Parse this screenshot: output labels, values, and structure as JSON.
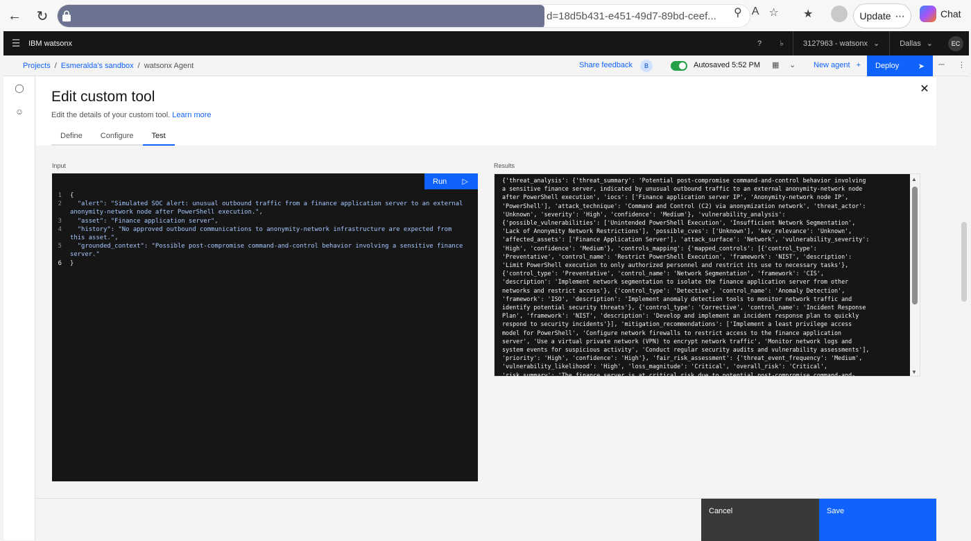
{
  "browser": {
    "url_visible": "d=18d5b431-e451-49d7-89bd-ceef...",
    "update_label": "Update",
    "chat_label": "Chat"
  },
  "app": {
    "brand": "IBM watsonx",
    "account": "3127963 - watsonx",
    "region": "Dallas",
    "avatar": "EC"
  },
  "subheader": {
    "crumb1": "Projects",
    "crumb2": "Esmeralda's sandbox",
    "crumb3": "watsonx Agent",
    "sep": "/",
    "share_feedback": "Share feedback",
    "badge": "B",
    "autosaved": "Autosaved 5:52 PM",
    "new_agent": "New agent",
    "deploy": "Deploy"
  },
  "modal": {
    "title": "Edit custom tool",
    "subtitle": "Edit the details of your custom tool.",
    "learn_more": "Learn more",
    "tabs": [
      "Define",
      "Configure",
      "Test"
    ],
    "active_tab": "Test",
    "input_label": "Input",
    "results_label": "Results",
    "run_label": "Run",
    "cancel_label": "Cancel",
    "save_label": "Save"
  },
  "input_code": {
    "l1": "{",
    "l2": "  \"alert\": \"Simulated SOC alert: unusual outbound traffic from a finance application server to an external anonymity-network node after PowerShell execution.\",",
    "l3": "  \"asset\": \"Finance application server\",",
    "l4": "  \"history\": \"No approved outbound communications to anonymity-network infrastructure are expected from this asset.\",",
    "l5": "  \"grounded_context\": \"Possible post-compromise command-and-control behavior involving a sensitive finance server.\"",
    "l6": "}"
  },
  "results_text": "{'threat_analysis': {'threat_summary': 'Potential post-compromise command-and-control behavior involving\na sensitive finance server, indicated by unusual outbound traffic to an external anonymity-network node\nafter PowerShell execution', 'iocs': ['Finance application server IP', 'Anonymity-network node IP',\n'PowerShell'], 'attack_technique': 'Command and Control (C2) via anonymization network', 'threat_actor':\n'Unknown', 'severity': 'High', 'confidence': 'Medium'}, 'vulnerability_analysis':\n{'possible_vulnerabilities': ['Unintended PowerShell Execution', 'Insufficient Network Segmentation',\n'Lack of Anonymity Network Restrictions'], 'possible_cves': ['Unknown'], 'kev_relevance': 'Unknown',\n'affected_assets': ['Finance Application Server'], 'attack_surface': 'Network', 'vulnerability_severity':\n'High', 'confidence': 'Medium'}, 'controls_mapping': {'mapped_controls': [{'control_type':\n'Preventative', 'control_name': 'Restrict PowerShell Execution', 'framework': 'NIST', 'description':\n'Limit PowerShell execution to only authorized personnel and restrict its use to necessary tasks'},\n{'control_type': 'Preventative', 'control_name': 'Network Segmentation', 'framework': 'CIS',\n'description': 'Implement network segmentation to isolate the finance application server from other\nnetworks and restrict access'}, {'control_type': 'Detective', 'control_name': 'Anomaly Detection',\n'framework': 'ISO', 'description': 'Implement anomaly detection tools to monitor network traffic and\nidentify potential security threats'}, {'control_type': 'Corrective', 'control_name': 'Incident Response\nPlan', 'framework': 'NIST', 'description': 'Develop and implement an incident response plan to quickly\nrespond to security incidents'}], 'mitigation_recommendations': ['Implement a least privilege access\nmodel for PowerShell', 'Configure network firewalls to restrict access to the finance application\nserver', 'Use a virtual private network (VPN) to encrypt network traffic', 'Monitor network logs and\nsystem events for suspicious activity', 'Conduct regular security audits and vulnerability assessments'],\n'priority': 'High', 'confidence': 'High'}, 'fair_risk_assessment': {'threat_event_frequency': 'Medium',\n'vulnerability_likelihood': 'High', 'loss_magnitude': 'Critical', 'overall_risk': 'Critical',\n'risk_summary': 'The finance server is at critical risk due to potential post-compromise command-and-",
  "colors": {
    "ibm_blue": "#0f62fe",
    "dark": "#161616",
    "cancel": "#393939",
    "toggle_on": "#24a148"
  }
}
